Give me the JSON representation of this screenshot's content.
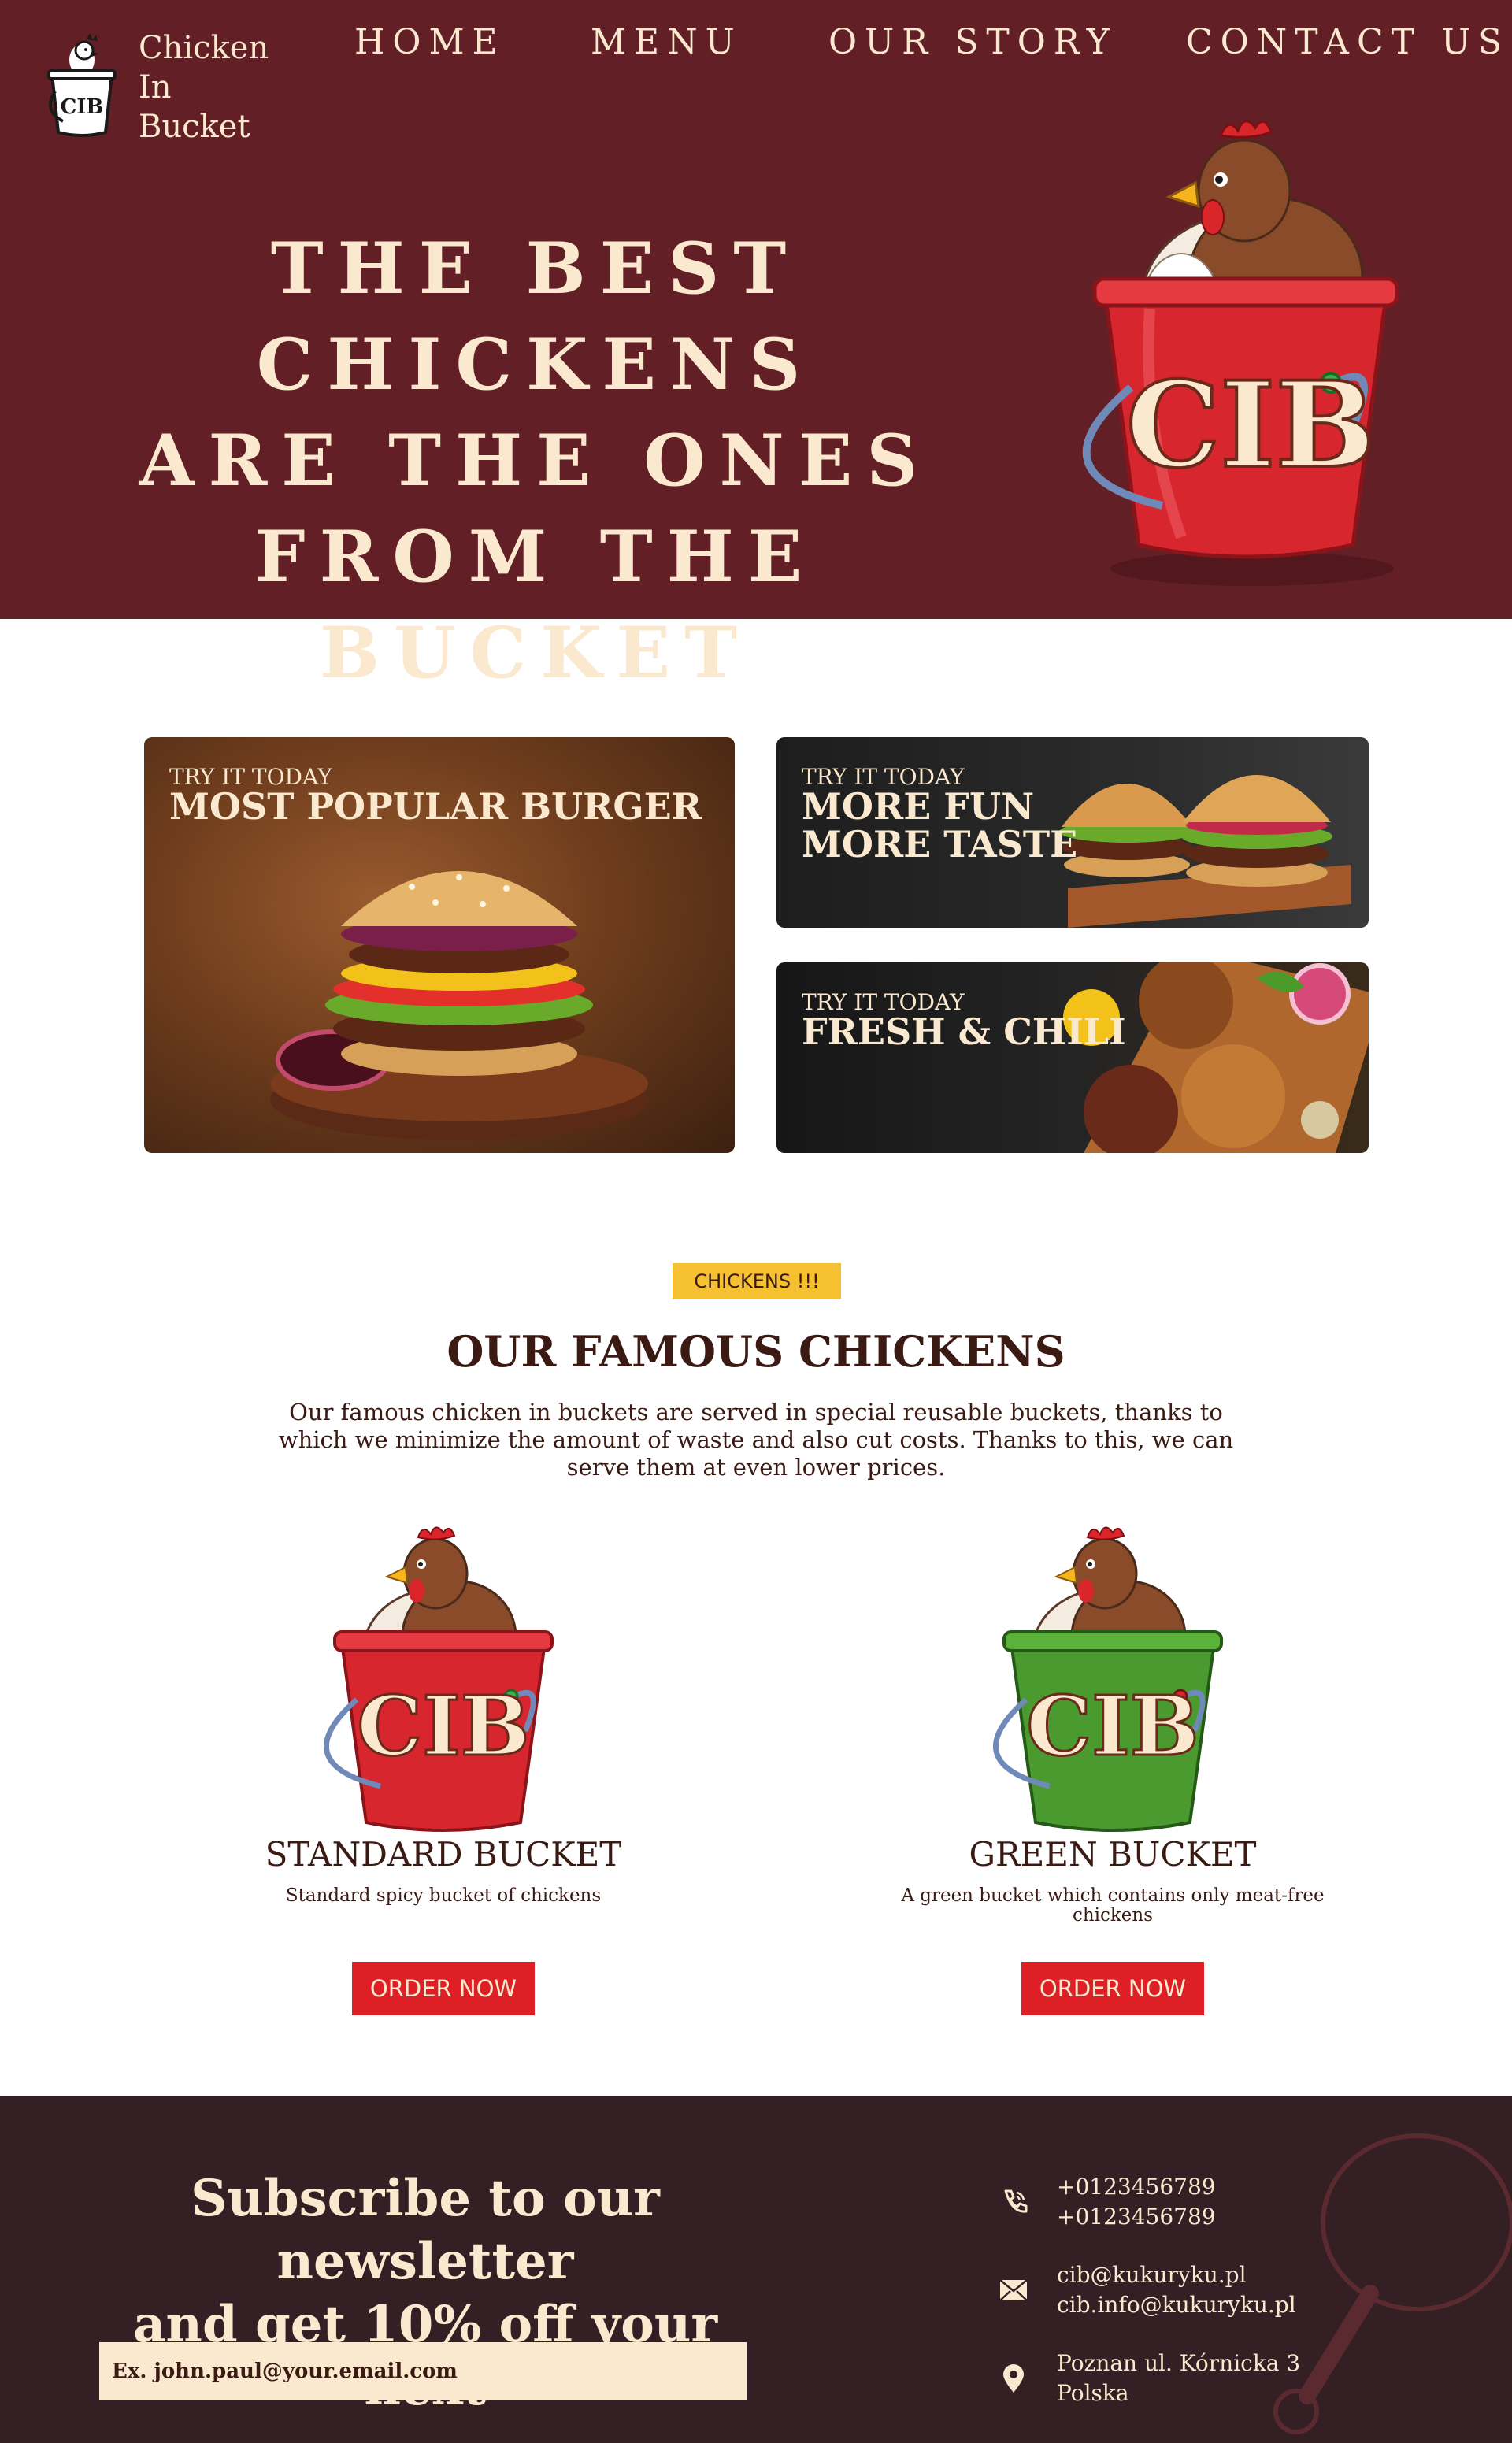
{
  "brand": {
    "name_lines": [
      "Chicken",
      "In",
      "Bucket"
    ],
    "logo_text": "CIB"
  },
  "nav": {
    "items": [
      "HOME",
      "MENU",
      "OUR STORY",
      "CONTACT US"
    ]
  },
  "hero": {
    "title_lines": [
      "THE BEST CHICKENS",
      "ARE THE ONES",
      "FROM THE BUCKET"
    ],
    "bucket_text": "CIB"
  },
  "promos": [
    {
      "eyebrow": "TRY IT TODAY",
      "title_lines": [
        "MOST POPULAR BURGER"
      ]
    },
    {
      "eyebrow": "TRY IT TODAY",
      "title_lines": [
        "MORE FUN",
        "MORE TASTE"
      ]
    },
    {
      "eyebrow": "TRY IT TODAY",
      "title_lines": [
        "FRESH & CHILI"
      ]
    }
  ],
  "chickens": {
    "badge": "CHICKENS !!!",
    "title": "OUR FAMOUS CHICKENS",
    "description": "Our famous chicken in buckets are served in special reusable buckets, thanks to which we minimize the amount of waste and also cut costs. Thanks to this, we can serve them at even lower prices.",
    "products": [
      {
        "name": "STANDARD BUCKET",
        "description": "Standard spicy bucket of chickens",
        "button": "ORDER NOW",
        "bucket_text": "CIB"
      },
      {
        "name": "GREEN BUCKET",
        "description": "A green bucket which contains only meat-free chickens",
        "button": "ORDER NOW",
        "bucket_text": "CIB"
      }
    ]
  },
  "footer": {
    "newsletter_lines": [
      "Subscribe to our newsletter",
      "and get 10% off your next"
    ],
    "email_placeholder": "Ex. john.paul@your.email.com",
    "phones": [
      "+0123456789",
      "+0123456789"
    ],
    "emails": [
      "cib@kukuryku.pl",
      "cib.info@kukuryku.pl"
    ],
    "address_lines": [
      "Poznan ul. Kórnicka 3",
      "Polska"
    ]
  },
  "colors": {
    "hero_bg": "#621f26",
    "cream": "#fbe9cf",
    "badge": "#f6c131",
    "button": "#df1f26",
    "footer_bg": "#331f24",
    "text_dark": "#3b1a14"
  }
}
